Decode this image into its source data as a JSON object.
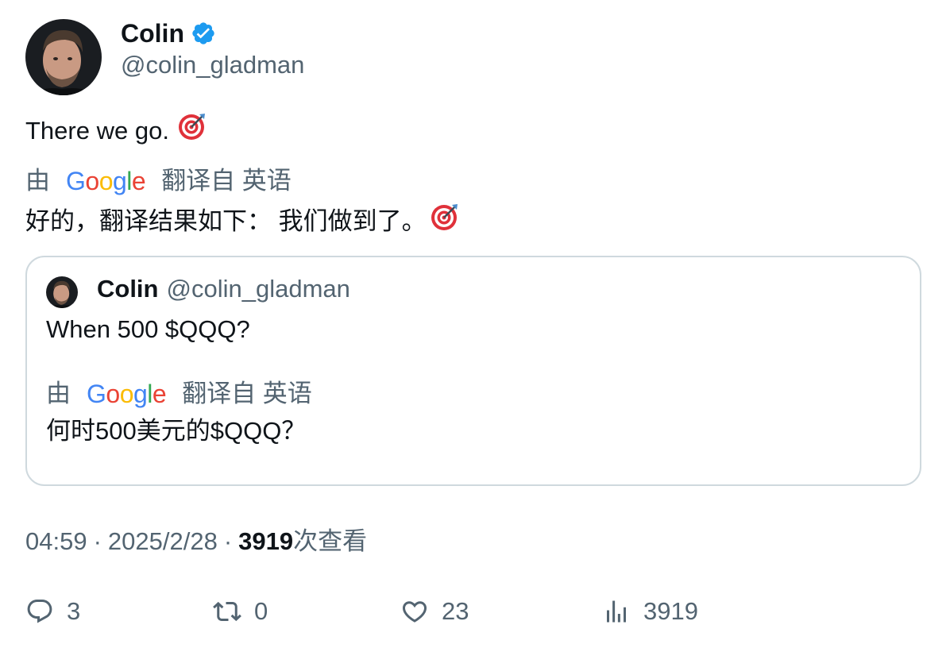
{
  "author": {
    "name": "Colin",
    "handle": "@colin_gladman"
  },
  "tweet": {
    "text": "There we go.",
    "emoji": "direct-hit-target-icon"
  },
  "translation": {
    "prefix": "由",
    "provider": [
      "G",
      "o",
      "o",
      "g",
      "l",
      "e"
    ],
    "suffix": "翻译自 英语",
    "text": "好的，翻译结果如下： 我们做到了。"
  },
  "quoted_tweet": {
    "name": "Colin",
    "handle": "@colin_gladman",
    "text": "When 500 $QQQ?",
    "translation_prefix": "由",
    "translation_suffix": "翻译自 英语",
    "translated_text": "何时500美元的$QQQ？"
  },
  "meta": {
    "time": "04:59",
    "separator": "·",
    "date": "2025/2/28",
    "views_count": "3919",
    "views_label": "次查看"
  },
  "actions": {
    "replies": "3",
    "reposts": "0",
    "likes": "23",
    "views": "3919"
  },
  "colors": {
    "verified": "#1d9bf0",
    "secondary_text": "#536471",
    "card_border": "#cfd9de",
    "google_blue": "#4285f4",
    "google_red": "#ea4335",
    "google_yellow": "#fbbc05",
    "google_green": "#34a853"
  }
}
